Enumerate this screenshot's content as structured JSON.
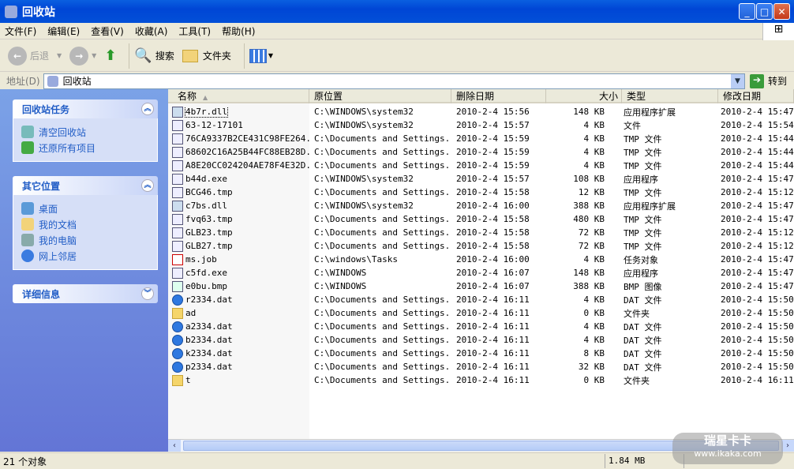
{
  "window": {
    "title": "回收站",
    "minimize": "_",
    "maximize": "□",
    "close": "✕"
  },
  "menu": [
    "文件(F)",
    "编辑(E)",
    "查看(V)",
    "收藏(A)",
    "工具(T)",
    "帮助(H)"
  ],
  "toolbar": {
    "back": "后退",
    "search": "搜索",
    "folders": "文件夹"
  },
  "address": {
    "label": "地址(D)",
    "value": "回收站",
    "go": "转到"
  },
  "tasks": {
    "title": "回收站任务",
    "items": [
      "清空回收站",
      "还原所有项目"
    ]
  },
  "places": {
    "title": "其它位置",
    "items": [
      "桌面",
      "我的文档",
      "我的电脑",
      "网上邻居"
    ]
  },
  "details": {
    "title": "详细信息"
  },
  "columns": [
    "名称",
    "原位置",
    "删除日期",
    "大小",
    "类型",
    "修改日期"
  ],
  "files": [
    {
      "icon": "dll",
      "name": "4b7r.dll",
      "origin": "C:\\WINDOWS\\system32",
      "deleted": "2010-2-4 15:56",
      "size": "148 KB",
      "type": "应用程序扩展",
      "modified": "2010-2-4 15:47"
    },
    {
      "icon": "tmp",
      "name": "63-12-17101",
      "origin": "C:\\WINDOWS\\system32",
      "deleted": "2010-2-4 15:57",
      "size": "4 KB",
      "type": "文件",
      "modified": "2010-2-4 15:54"
    },
    {
      "icon": "tmp",
      "name": "76CA9337B2CE431C98FE264...",
      "origin": "C:\\Documents and Settings...",
      "deleted": "2010-2-4 15:59",
      "size": "4 KB",
      "type": "TMP 文件",
      "modified": "2010-2-4 15:44"
    },
    {
      "icon": "tmp",
      "name": "68602C16A25B44FC88EB28D...",
      "origin": "C:\\Documents and Settings...",
      "deleted": "2010-2-4 15:59",
      "size": "4 KB",
      "type": "TMP 文件",
      "modified": "2010-2-4 15:44"
    },
    {
      "icon": "tmp",
      "name": "A8E20CC024204AE78F4E32D...",
      "origin": "C:\\Documents and Settings...",
      "deleted": "2010-2-4 15:59",
      "size": "4 KB",
      "type": "TMP 文件",
      "modified": "2010-2-4 15:44"
    },
    {
      "icon": "exe",
      "name": "b44d.exe",
      "origin": "C:\\WINDOWS\\system32",
      "deleted": "2010-2-4 15:57",
      "size": "108 KB",
      "type": "应用程序",
      "modified": "2010-2-4 15:47"
    },
    {
      "icon": "tmp",
      "name": "BCG46.tmp",
      "origin": "C:\\Documents and Settings...",
      "deleted": "2010-2-4 15:58",
      "size": "12 KB",
      "type": "TMP 文件",
      "modified": "2010-2-4 15:12"
    },
    {
      "icon": "dll",
      "name": "c7bs.dll",
      "origin": "C:\\WINDOWS\\system32",
      "deleted": "2010-2-4 16:00",
      "size": "388 KB",
      "type": "应用程序扩展",
      "modified": "2010-2-4 15:47"
    },
    {
      "icon": "tmp",
      "name": "fvq63.tmp",
      "origin": "C:\\Documents and Settings...",
      "deleted": "2010-2-4 15:58",
      "size": "480 KB",
      "type": "TMP 文件",
      "modified": "2010-2-4 15:47"
    },
    {
      "icon": "tmp",
      "name": "GLB23.tmp",
      "origin": "C:\\Documents and Settings...",
      "deleted": "2010-2-4 15:58",
      "size": "72 KB",
      "type": "TMP 文件",
      "modified": "2010-2-4 15:12"
    },
    {
      "icon": "tmp",
      "name": "GLB27.tmp",
      "origin": "C:\\Documents and Settings...",
      "deleted": "2010-2-4 15:58",
      "size": "72 KB",
      "type": "TMP 文件",
      "modified": "2010-2-4 15:12"
    },
    {
      "icon": "job",
      "name": "ms.job",
      "origin": "C:\\windows\\Tasks",
      "deleted": "2010-2-4 16:00",
      "size": "4 KB",
      "type": "任务对象",
      "modified": "2010-2-4 15:47"
    },
    {
      "icon": "exe",
      "name": "c5fd.exe",
      "origin": "C:\\WINDOWS",
      "deleted": "2010-2-4 16:07",
      "size": "148 KB",
      "type": "应用程序",
      "modified": "2010-2-4 15:47"
    },
    {
      "icon": "bmp",
      "name": "e0bu.bmp",
      "origin": "C:\\WINDOWS",
      "deleted": "2010-2-4 16:07",
      "size": "388 KB",
      "type": "BMP 图像",
      "modified": "2010-2-4 15:47"
    },
    {
      "icon": "dat",
      "name": "r2334.dat",
      "origin": "C:\\Documents and Settings...",
      "deleted": "2010-2-4 16:11",
      "size": "4 KB",
      "type": "DAT 文件",
      "modified": "2010-2-4 15:50"
    },
    {
      "icon": "folder",
      "name": "ad",
      "origin": "C:\\Documents and Settings...",
      "deleted": "2010-2-4 16:11",
      "size": "0 KB",
      "type": "文件夹",
      "modified": "2010-2-4 15:50"
    },
    {
      "icon": "dat",
      "name": "a2334.dat",
      "origin": "C:\\Documents and Settings...",
      "deleted": "2010-2-4 16:11",
      "size": "4 KB",
      "type": "DAT 文件",
      "modified": "2010-2-4 15:50"
    },
    {
      "icon": "dat",
      "name": "b2334.dat",
      "origin": "C:\\Documents and Settings...",
      "deleted": "2010-2-4 16:11",
      "size": "4 KB",
      "type": "DAT 文件",
      "modified": "2010-2-4 15:50"
    },
    {
      "icon": "dat",
      "name": "k2334.dat",
      "origin": "C:\\Documents and Settings...",
      "deleted": "2010-2-4 16:11",
      "size": "8 KB",
      "type": "DAT 文件",
      "modified": "2010-2-4 15:50"
    },
    {
      "icon": "dat",
      "name": "p2334.dat",
      "origin": "C:\\Documents and Settings...",
      "deleted": "2010-2-4 16:11",
      "size": "32 KB",
      "type": "DAT 文件",
      "modified": "2010-2-4 15:50"
    },
    {
      "icon": "folder",
      "name": "t",
      "origin": "C:\\Documents and Settings...",
      "deleted": "2010-2-4 16:11",
      "size": "0 KB",
      "type": "文件夹",
      "modified": "2010-2-4 16:11"
    }
  ],
  "status": {
    "count": "21 个对象",
    "size": "1.84 MB"
  },
  "watermark": {
    "title": "瑞星卡卡",
    "url": "www.ikaka.com"
  }
}
